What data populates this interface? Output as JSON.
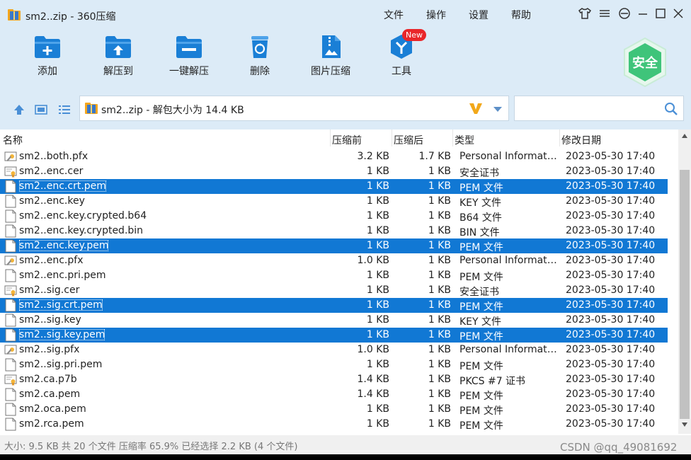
{
  "window": {
    "title": "sm2..zip - 360压缩"
  },
  "menu": [
    "文件",
    "操作",
    "设置",
    "帮助"
  ],
  "toolbar": {
    "add": "添加",
    "extract_to": "解压到",
    "one_click_extract": "一键解压",
    "delete": "删除",
    "image_compress": "图片压缩",
    "tools": "工具",
    "new_badge": "New",
    "security_badge": "安全"
  },
  "path_bar": {
    "text": "sm2..zip - 解包大小为 14.4 KB",
    "search_placeholder": ""
  },
  "columns": {
    "name": "名称",
    "before": "压缩前",
    "after": "压缩后",
    "type": "类型",
    "modified": "修改日期"
  },
  "files": [
    {
      "name": "sm2..both.pfx",
      "before": "3.2 KB",
      "after": "1.7 KB",
      "type": "Personal Information Exchange",
      "date": "2023-05-30 17:40",
      "icon": "pfx-icon",
      "selected": false
    },
    {
      "name": "sm2..enc.cer",
      "before": "1 KB",
      "after": "1 KB",
      "type": "安全证书",
      "date": "2023-05-30 17:40",
      "icon": "cert-icon",
      "selected": false
    },
    {
      "name": "sm2..enc.crt.pem",
      "before": "1 KB",
      "after": "1 KB",
      "type": "PEM 文件",
      "date": "2023-05-30 17:40",
      "icon": "file-icon",
      "selected": true
    },
    {
      "name": "sm2..enc.key",
      "before": "1 KB",
      "after": "1 KB",
      "type": "KEY 文件",
      "date": "2023-05-30 17:40",
      "icon": "file-icon",
      "selected": false
    },
    {
      "name": "sm2..enc.key.crypted.b64",
      "before": "1 KB",
      "after": "1 KB",
      "type": "B64 文件",
      "date": "2023-05-30 17:40",
      "icon": "file-icon",
      "selected": false
    },
    {
      "name": "sm2..enc.key.crypted.bin",
      "before": "1 KB",
      "after": "1 KB",
      "type": "BIN 文件",
      "date": "2023-05-30 17:40",
      "icon": "file-icon",
      "selected": false
    },
    {
      "name": "sm2..enc.key.pem",
      "before": "1 KB",
      "after": "1 KB",
      "type": "PEM 文件",
      "date": "2023-05-30 17:40",
      "icon": "file-icon",
      "selected": true
    },
    {
      "name": "sm2..enc.pfx",
      "before": "1.0 KB",
      "after": "1 KB",
      "type": "Personal Information Exchange",
      "date": "2023-05-30 17:40",
      "icon": "pfx-icon",
      "selected": false
    },
    {
      "name": "sm2..enc.pri.pem",
      "before": "1 KB",
      "after": "1 KB",
      "type": "PEM 文件",
      "date": "2023-05-30 17:40",
      "icon": "file-icon",
      "selected": false
    },
    {
      "name": "sm2..sig.cer",
      "before": "1 KB",
      "after": "1 KB",
      "type": "安全证书",
      "date": "2023-05-30 17:40",
      "icon": "cert-icon",
      "selected": false
    },
    {
      "name": "sm2..sig.crt.pem",
      "before": "1 KB",
      "after": "1 KB",
      "type": "PEM 文件",
      "date": "2023-05-30 17:40",
      "icon": "file-icon",
      "selected": true
    },
    {
      "name": "sm2..sig.key",
      "before": "1 KB",
      "after": "1 KB",
      "type": "KEY 文件",
      "date": "2023-05-30 17:40",
      "icon": "file-icon",
      "selected": false
    },
    {
      "name": "sm2..sig.key.pem",
      "before": "1 KB",
      "after": "1 KB",
      "type": "PEM 文件",
      "date": "2023-05-30 17:40",
      "icon": "file-icon",
      "selected": true
    },
    {
      "name": "sm2..sig.pfx",
      "before": "1.0 KB",
      "after": "1 KB",
      "type": "Personal Information Exchange",
      "date": "2023-05-30 17:40",
      "icon": "pfx-icon",
      "selected": false
    },
    {
      "name": "sm2..sig.pri.pem",
      "before": "1 KB",
      "after": "1 KB",
      "type": "PEM 文件",
      "date": "2023-05-30 17:40",
      "icon": "file-icon",
      "selected": false
    },
    {
      "name": "sm2.ca.p7b",
      "before": "1.4 KB",
      "after": "1 KB",
      "type": "PKCS #7 证书",
      "date": "2023-05-30 17:40",
      "icon": "cert-icon",
      "selected": false
    },
    {
      "name": "sm2.ca.pem",
      "before": "1.4 KB",
      "after": "1 KB",
      "type": "PEM 文件",
      "date": "2023-05-30 17:40",
      "icon": "file-icon",
      "selected": false
    },
    {
      "name": "sm2.oca.pem",
      "before": "1 KB",
      "after": "1 KB",
      "type": "PEM 文件",
      "date": "2023-05-30 17:40",
      "icon": "file-icon",
      "selected": false
    },
    {
      "name": "sm2.rca.pem",
      "before": "1 KB",
      "after": "1 KB",
      "type": "PEM 文件",
      "date": "2023-05-30 17:40",
      "icon": "file-icon",
      "selected": false
    }
  ],
  "status": {
    "text": "大小: 9.5 KB 共 20 个文件 压缩率 65.9% 已经选择 2.2 KB (4 个文件)"
  },
  "watermark": "CSDN @qq_49081692",
  "colors": {
    "accent": "#1a7fd6",
    "selected_row": "#1178d4",
    "top_bg": "#dcebf7",
    "badge_red": "#e9262a",
    "shield_green": "#3fc47a"
  }
}
